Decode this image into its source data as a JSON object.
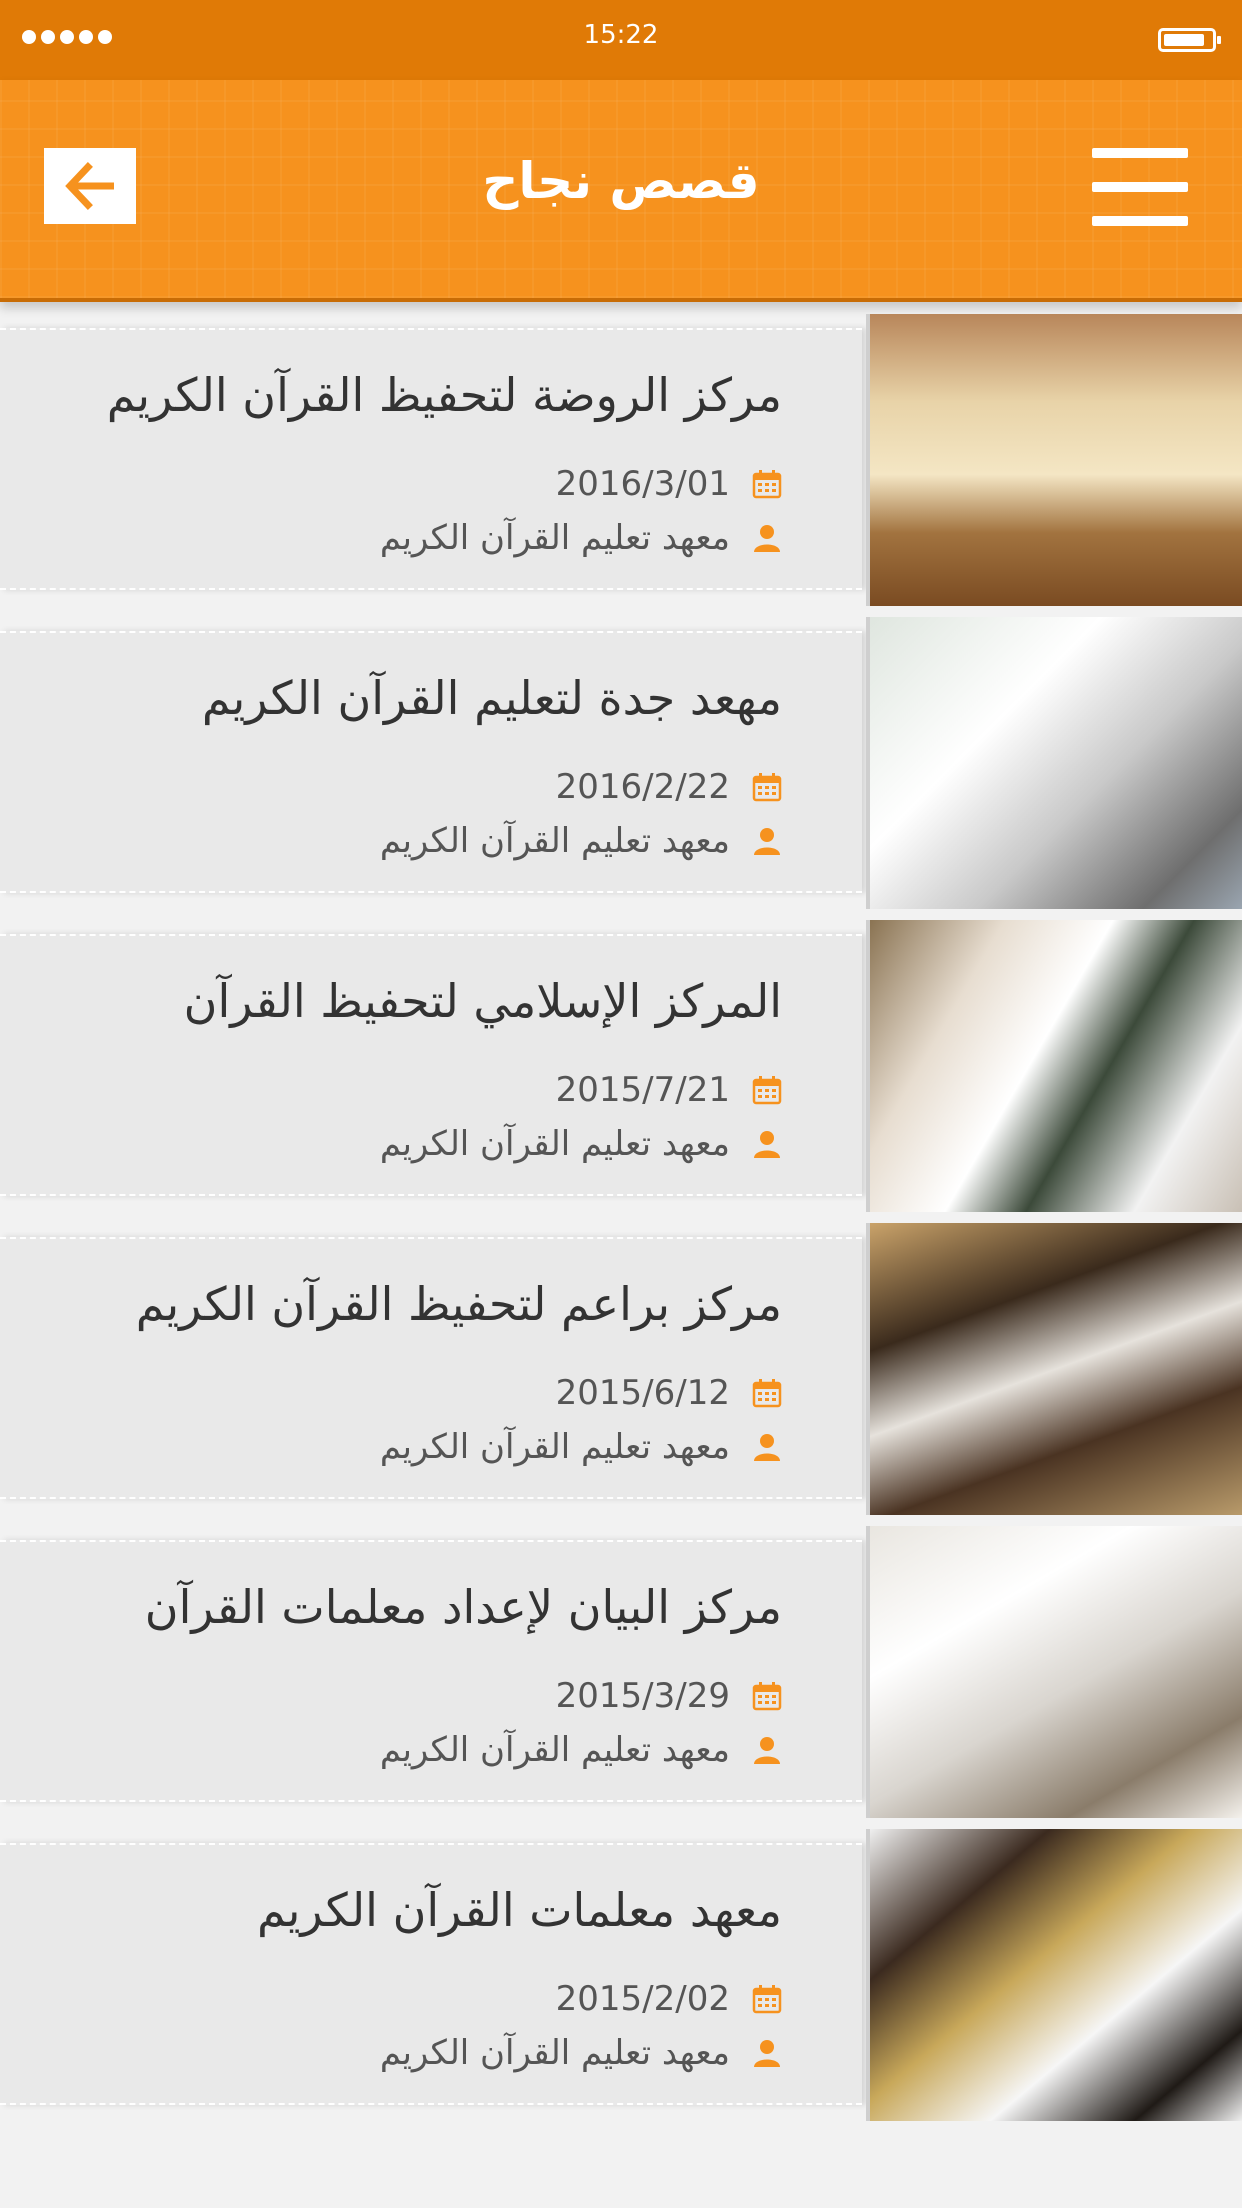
{
  "status_bar": {
    "time": "15:22"
  },
  "header": {
    "title": "قصص نجاح",
    "back_icon": "arrow-left-icon",
    "menu_icon": "hamburger-menu-icon"
  },
  "colors": {
    "accent": "#f6921e",
    "status_bar": "#e07a06",
    "card_bg": "#e9e9e9",
    "text": "#333333"
  },
  "stories": [
    {
      "title": "مركز الروضة لتحفيظ القرآن الكريم",
      "date": "2016/3/01",
      "author": "معهد تعليم القرآن الكريم",
      "image": "mosque-interior-photo"
    },
    {
      "title": "مهعد جدة لتعليم القرآن الكريم",
      "date": "2016/2/22",
      "author": "معهد تعليم القرآن الكريم",
      "image": "meeting-table-photo"
    },
    {
      "title": "المركز الإسلامي لتحفيظ القرآن",
      "date": "2015/7/21",
      "author": "معهد تعليم القرآن الكريم",
      "image": "award-ceremony-photo"
    },
    {
      "title": "مركز براعم لتحفيظ القرآن الكريم",
      "date": "2015/6/12",
      "author": "معهد تعليم القرآن الكريم",
      "image": "officials-group-photo"
    },
    {
      "title": "مركز البيان لإعداد معلمات القرآن",
      "date": "2015/3/29",
      "author": "معهد تعليم القرآن الكريم",
      "image": "conference-photo"
    },
    {
      "title": "معهد معلمات القرآن الكريم",
      "date": "2015/2/02",
      "author": "معهد تعليم القرآن الكريم",
      "image": "ribbon-cutting-photo"
    }
  ]
}
